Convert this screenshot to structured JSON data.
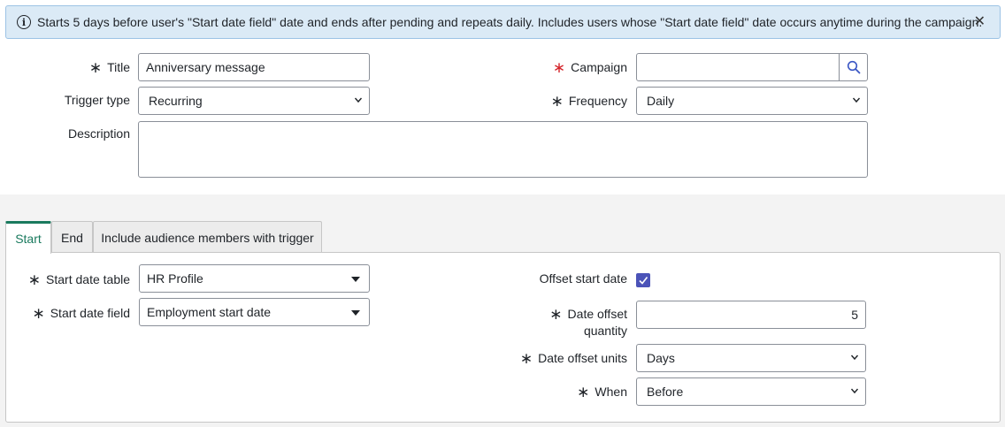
{
  "banner": {
    "message": "Starts 5 days before user's \"Start date field\" date and ends after pending and repeats daily. Includes users whose \"Start date field\" date occurs anytime during the campaign.",
    "info_icon": "i",
    "close_glyph": "✕"
  },
  "form": {
    "title": {
      "label": "Title",
      "value": "Anniversary message"
    },
    "campaign": {
      "label": "Campaign",
      "value": ""
    },
    "trigger_type": {
      "label": "Trigger type",
      "value": "Recurring"
    },
    "frequency": {
      "label": "Frequency",
      "value": "Daily"
    },
    "description": {
      "label": "Description",
      "value": ""
    },
    "required_mark": "∗"
  },
  "tabs": [
    {
      "label": "Start",
      "active": true
    },
    {
      "label": "End",
      "active": false
    },
    {
      "label": "Include audience members with trigger",
      "active": false
    }
  ],
  "start_tab": {
    "start_date_table": {
      "label": "Start date table",
      "value": "HR Profile"
    },
    "start_date_field": {
      "label": "Start date field",
      "value": "Employment start date"
    },
    "offset_start_date": {
      "label": "Offset start date",
      "checked": true
    },
    "date_offset_quantity": {
      "label_line1": "Date offset",
      "label_line2": "quantity",
      "value": "5"
    },
    "date_offset_units": {
      "label": "Date offset units",
      "value": "Days"
    },
    "when": {
      "label": "When",
      "value": "Before"
    }
  },
  "colors": {
    "banner_bg": "#dbeaf6",
    "required_red": "#d4242a",
    "tab_active": "#1a7a5e",
    "checkbox": "#4b53b8"
  }
}
